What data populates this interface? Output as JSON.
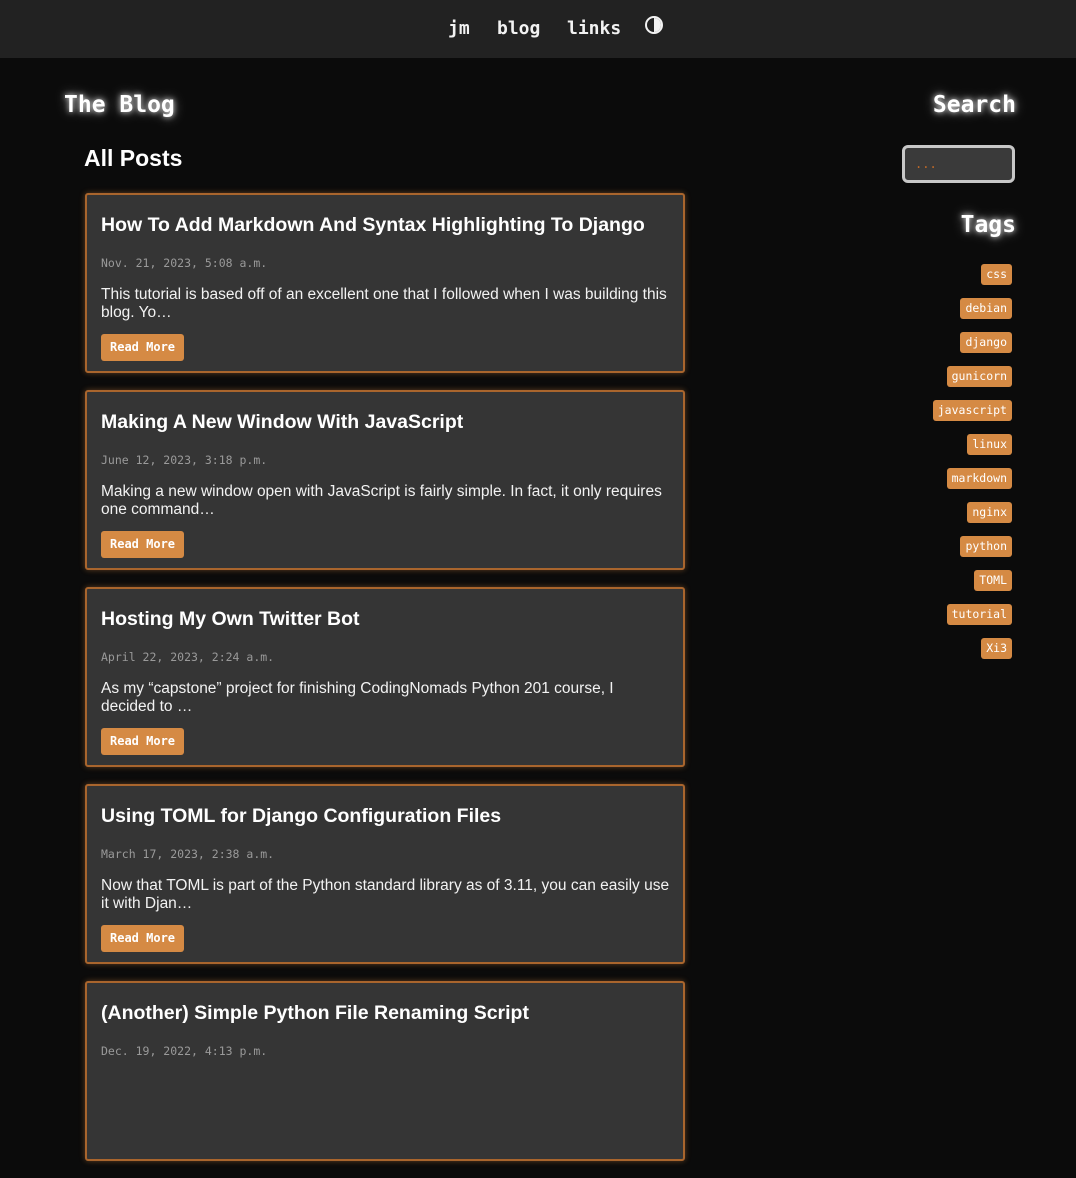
{
  "nav": {
    "items": [
      {
        "label": "jm"
      },
      {
        "label": "blog"
      },
      {
        "label": "links"
      }
    ],
    "theme_toggle_icon": "half-circle-contrast-icon"
  },
  "blog_heading": "The Blog",
  "section_heading": "All Posts",
  "posts": [
    {
      "title": "How To Add Markdown And Syntax Highlighting To Django",
      "date": "Nov. 21, 2023, 5:08 a.m.",
      "excerpt": "This tutorial is based off of an excellent one that I followed when I was building this blog. Yo…",
      "button": "Read More"
    },
    {
      "title": "Making A New Window With JavaScript",
      "date": "June 12, 2023, 3:18 p.m.",
      "excerpt": "Making a new window open with JavaScript is fairly simple. In fact, it only requires one command…",
      "button": "Read More"
    },
    {
      "title": "Hosting My Own Twitter Bot",
      "date": "April 22, 2023, 2:24 a.m.",
      "excerpt": "As my “capstone” project for finishing CodingNomads Python 201 course, I decided to …",
      "button": "Read More"
    },
    {
      "title": "Using TOML for Django Configuration Files",
      "date": "March 17, 2023, 2:38 a.m.",
      "excerpt": "Now that TOML is part of the Python standard library as of 3.11, you can easily use it with Djan…",
      "button": "Read More"
    },
    {
      "title": "(Another) Simple Python File Renaming Script",
      "date": "Dec. 19, 2022, 4:13 p.m.",
      "excerpt": "",
      "button": ""
    }
  ],
  "search": {
    "heading": "Search",
    "placeholder": "..."
  },
  "tags": {
    "heading": "Tags",
    "items": [
      "css",
      "debian",
      "django",
      "gunicorn",
      "javascript",
      "linux",
      "markdown",
      "nginx",
      "python",
      "TOML",
      "tutorial",
      "Xi3"
    ]
  },
  "colors": {
    "accent": "#d58a44",
    "card_border": "#a9652d",
    "background": "#0b0b0b",
    "nav_background": "#222222",
    "card_background": "#353535"
  }
}
